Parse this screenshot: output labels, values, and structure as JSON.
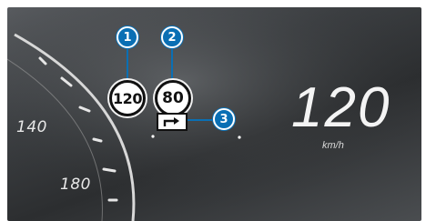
{
  "speed_limit_signs": [
    {
      "callout": "1",
      "value": "120"
    },
    {
      "callout": "2",
      "value": "80"
    }
  ],
  "turn_indicator": {
    "callout": "3",
    "icon": "arrow-right-turn-icon"
  },
  "speedometer": {
    "scale_labels": [
      "140",
      "180"
    ],
    "current_speed": "120",
    "unit": "km/h"
  },
  "colors": {
    "callout": "#0a6fb4",
    "dashboard": "#3b3e41",
    "sign_fill": "#ffffff",
    "sign_border": "#111111"
  }
}
